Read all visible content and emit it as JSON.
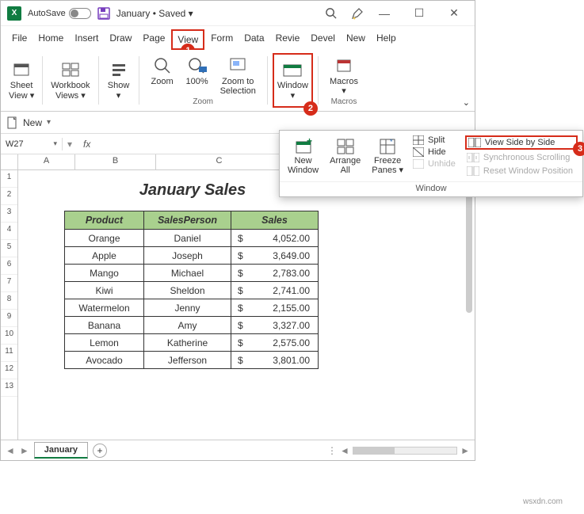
{
  "titlebar": {
    "autosave": "AutoSave",
    "doc": "January • Saved ▾"
  },
  "tabs": [
    "File",
    "Home",
    "Insert",
    "Draw",
    "Page",
    "View",
    "Form",
    "Data",
    "Revie",
    "Devel",
    "New",
    "Help"
  ],
  "active_tab_index": 5,
  "ribbon": {
    "sheet_view": "Sheet\nView ▾",
    "workbook_views": "Workbook\nViews ▾",
    "show": "Show\n▾",
    "zoom": "Zoom",
    "hundred": "100%",
    "zoom_sel": "Zoom to\nSelection",
    "zoom_group": "Zoom",
    "window": "Window\n▾",
    "macros": "Macros\n▾",
    "macros_group": "Macros"
  },
  "qa": {
    "new": "New",
    "arrow": "▾"
  },
  "namebox": "W27",
  "colheaders": {
    "A": "A",
    "B": "B",
    "C": "C"
  },
  "title": "January Sales",
  "headers": {
    "product": "Product",
    "person": "SalesPerson",
    "sales": "Sales"
  },
  "rows": [
    {
      "p": "Orange",
      "s": "Daniel",
      "v": "4,052.00"
    },
    {
      "p": "Apple",
      "s": "Joseph",
      "v": "3,649.00"
    },
    {
      "p": "Mango",
      "s": "Michael",
      "v": "2,783.00"
    },
    {
      "p": "Kiwi",
      "s": "Sheldon",
      "v": "2,741.00"
    },
    {
      "p": "Watermelon",
      "s": "Jenny",
      "v": "2,155.00"
    },
    {
      "p": "Banana",
      "s": "Amy",
      "v": "3,327.00"
    },
    {
      "p": "Lemon",
      "s": "Katherine",
      "v": "2,575.00"
    },
    {
      "p": "Avocado",
      "s": "Jefferson",
      "v": "3,801.00"
    }
  ],
  "rownums": [
    "1",
    "2",
    "3",
    "4",
    "5",
    "6",
    "7",
    "8",
    "9",
    "10",
    "11",
    "12",
    "13"
  ],
  "sheet_tab": "January",
  "dropdown": {
    "new_window": "New\nWindow",
    "arrange": "Arrange\nAll",
    "freeze": "Freeze\nPanes ▾",
    "split": "Split",
    "hide": "Hide",
    "unhide": "Unhide",
    "side": "View Side by Side",
    "sync": "Synchronous Scrolling",
    "reset": "Reset Window Position",
    "group": "Window"
  },
  "badges": {
    "b1": "1",
    "b2": "2",
    "b3": "3"
  },
  "watermark": "wsxdn.com"
}
